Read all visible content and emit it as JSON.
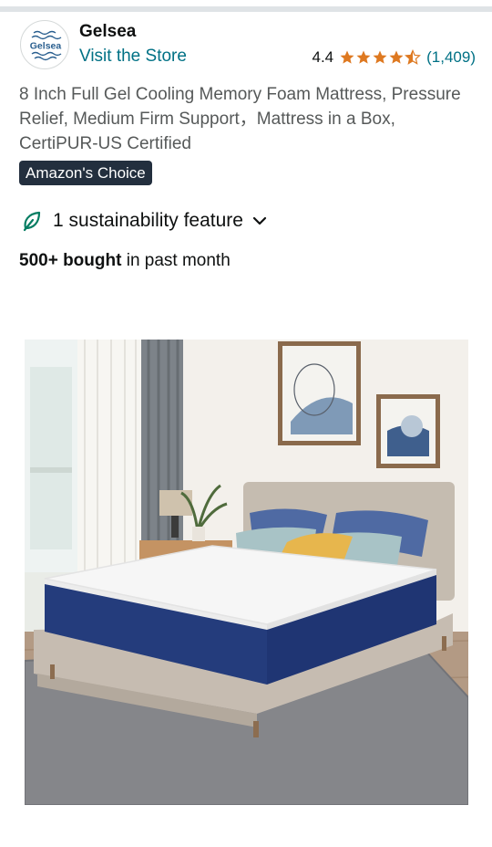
{
  "brand": {
    "logo_text": "Gelsea",
    "name": "Gelsea",
    "visit_store": "Visit the Store"
  },
  "rating": {
    "value": "4.4",
    "stars": 4.4,
    "count": "(1,409)"
  },
  "product": {
    "title": "8 Inch Full Gel Cooling Memory Foam Mattress, Pressure Relief, Medium Firm Support，Mattress in a Box, CertiPUR-US Certified",
    "badge": "Amazon's Choice",
    "sustainability": "1 sustainability feature",
    "bought_bold": "500+ bought",
    "bought_rest": " in past month"
  },
  "colors": {
    "link": "#007185",
    "star": "#de7921",
    "badge_bg": "#232f3e",
    "leaf": "#067d62"
  },
  "icons": [
    "leaf-icon",
    "chevron-down-icon",
    "star-icon"
  ]
}
